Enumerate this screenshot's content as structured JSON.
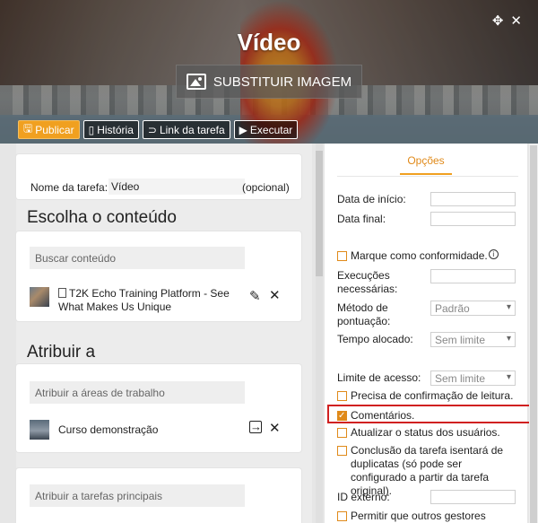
{
  "header": {
    "title": "Vídeo",
    "replace_image_label": "SUBSTITUIR IMAGEM",
    "toolbar": {
      "publish": "Publicar",
      "history": "História",
      "task_link": "Link da tarefa",
      "run": "Executar"
    }
  },
  "task": {
    "name_label": "Nome da tarefa:",
    "name_value": "Vídeo",
    "optional": "(opcional)"
  },
  "content": {
    "heading": "Escolha o conteúdo",
    "search_placeholder": "Buscar conteúdo",
    "item_title": "T2K Echo Training Platform - See What Makes Us Unique"
  },
  "assign": {
    "heading": "Atribuir a",
    "workspaces_placeholder": "Atribuir a áreas de trabalho",
    "item_title": "Curso demonstração",
    "parent_tasks_placeholder": "Atribuir a tarefas principais"
  },
  "options": {
    "tab_label": "Opções",
    "start_date_label": "Data de início:",
    "end_date_label": "Data final:",
    "compliance_label": "Marque como conformidade.",
    "executions_label": "Execuções necessárias:",
    "scoring_label": "Método de pontuação:",
    "scoring_value": "Padrão",
    "time_label": "Tempo alocado:",
    "time_value": "Sem limite",
    "access_label": "Limite de acesso:",
    "access_value": "Sem limite",
    "read_confirm_label": "Precisa de confirmação de leitura.",
    "comments_label": "Comentários.",
    "comments_checked": true,
    "update_status_label": "Atualizar o status dos usuários.",
    "exempt_label": "Conclusão da tarefa isentará de duplicatas (só pode ser configurado a partir da tarefa original).",
    "external_id_label": "ID externo:",
    "allow_managers_label": "Permitir que outros gestores"
  },
  "colors": {
    "accent": "#f0a020",
    "highlight": "#d02020"
  }
}
